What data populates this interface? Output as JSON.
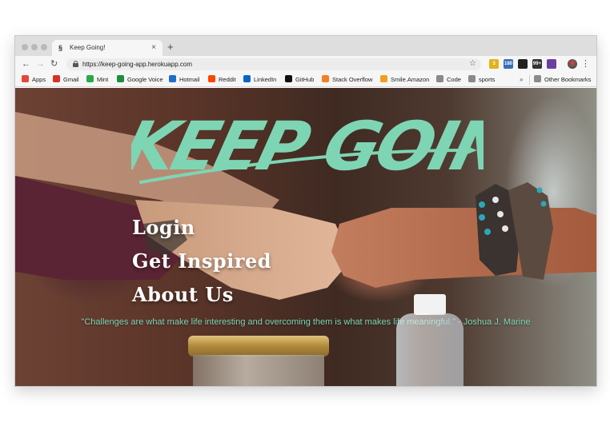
{
  "browser": {
    "tab": {
      "title": "Keep Going!",
      "favicon": "keep-going-favicon"
    },
    "new_tab_label": "+",
    "close_label": "×",
    "address": {
      "url": "https://keep-going-app.herokuapp.com"
    },
    "extensions": [
      {
        "name": "extension-1-icon",
        "color": "#e1b21a",
        "badge": "3"
      },
      {
        "name": "extension-2-icon",
        "color": "#3b6fb6",
        "badge": "180"
      },
      {
        "name": "extension-3-icon",
        "color": "#222222",
        "badge": ""
      },
      {
        "name": "extension-4-icon",
        "color": "#333333",
        "badge": "99+"
      },
      {
        "name": "extension-5-icon",
        "color": "#6b3fa0",
        "badge": ""
      }
    ],
    "bookmarks": [
      {
        "label": "Apps",
        "icon": "apps-grid-icon",
        "color": "#e04a3a"
      },
      {
        "label": "Gmail",
        "icon": "gmail-icon",
        "color": "#d93025"
      },
      {
        "label": "Mint",
        "icon": "mint-icon",
        "color": "#2aa84a"
      },
      {
        "label": "Google Voice",
        "icon": "google-voice-icon",
        "color": "#1e8e3e"
      },
      {
        "label": "Hotmail",
        "icon": "outlook-icon",
        "color": "#1f6fc8"
      },
      {
        "label": "Reddit",
        "icon": "reddit-icon",
        "color": "#ff4500"
      },
      {
        "label": "LinkedIn",
        "icon": "linkedin-icon",
        "color": "#0a66c2"
      },
      {
        "label": "GitHub",
        "icon": "github-icon",
        "color": "#111111"
      },
      {
        "label": "Stack Overflow",
        "icon": "stackoverflow-icon",
        "color": "#f48024"
      },
      {
        "label": "Smile.Amazon",
        "icon": "amazon-icon",
        "color": "#f0a020"
      },
      {
        "label": "Code",
        "icon": "folder-icon",
        "color": "#8a8a8a"
      },
      {
        "label": "sports",
        "icon": "folder-icon",
        "color": "#8a8a8a"
      }
    ],
    "more_bookmarks": "»",
    "other_bookmarks": "Other Bookmarks"
  },
  "page": {
    "logo_text": "KEEP GOING",
    "nav": [
      "Login",
      "Get Inspired",
      "About Us"
    ],
    "quote": "\"Challenges are what make life interesting and overcoming them is what makes life meaningful.\" - Joshua J. Marine"
  },
  "colors": {
    "accent": "#7ed5b4",
    "chrome": "#dedede",
    "toolbar": "#f6f6f6"
  }
}
